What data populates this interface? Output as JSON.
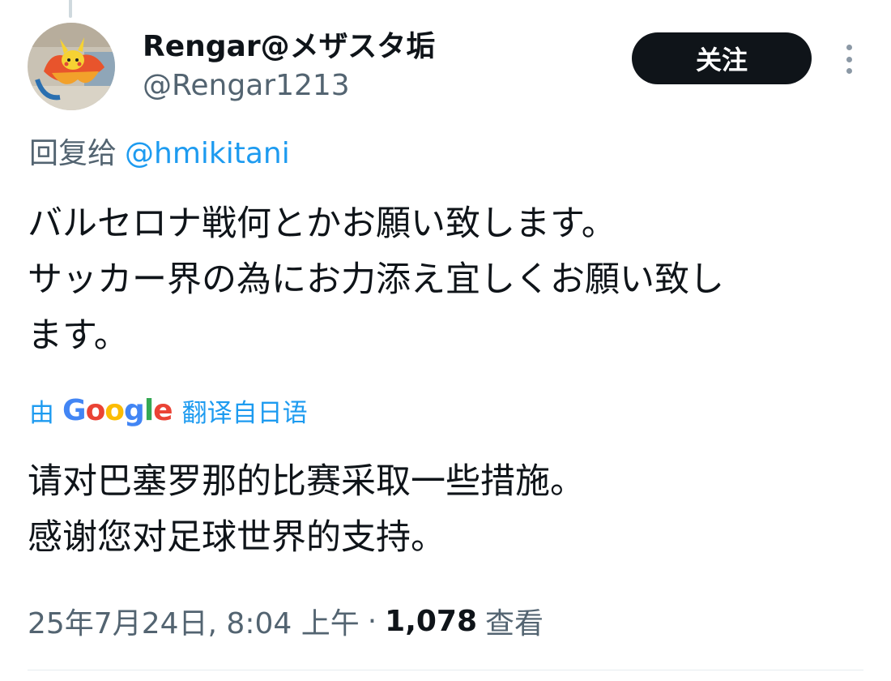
{
  "author": {
    "display_name": "Rengar@メザスタ垢",
    "handle": "@Rengar1213"
  },
  "actions": {
    "follow_label": "关注",
    "more_icon": "more-vertical-icon"
  },
  "reply": {
    "prefix": "回复给",
    "mention": "@hmikitani"
  },
  "tweet": {
    "lines": [
      "バルセロナ戦何とかお願い致します。",
      "サッカー界の為にお力添え宜しくお願い致し",
      "ます。"
    ]
  },
  "translation": {
    "by": "由",
    "logo": "Google",
    "suffix": "翻译自日语",
    "lines": [
      "请对巴塞罗那的比赛采取一些措施。",
      "感谢您对足球世界的支持。"
    ]
  },
  "meta": {
    "timestamp": "25年7月24日, 8:04 上午",
    "separator": "·",
    "views_count": "1,078",
    "views_label": "查看"
  },
  "colors": {
    "link": "#1d9bf0",
    "secondary_text": "#536471",
    "follow_button_bg": "#0f1419"
  }
}
